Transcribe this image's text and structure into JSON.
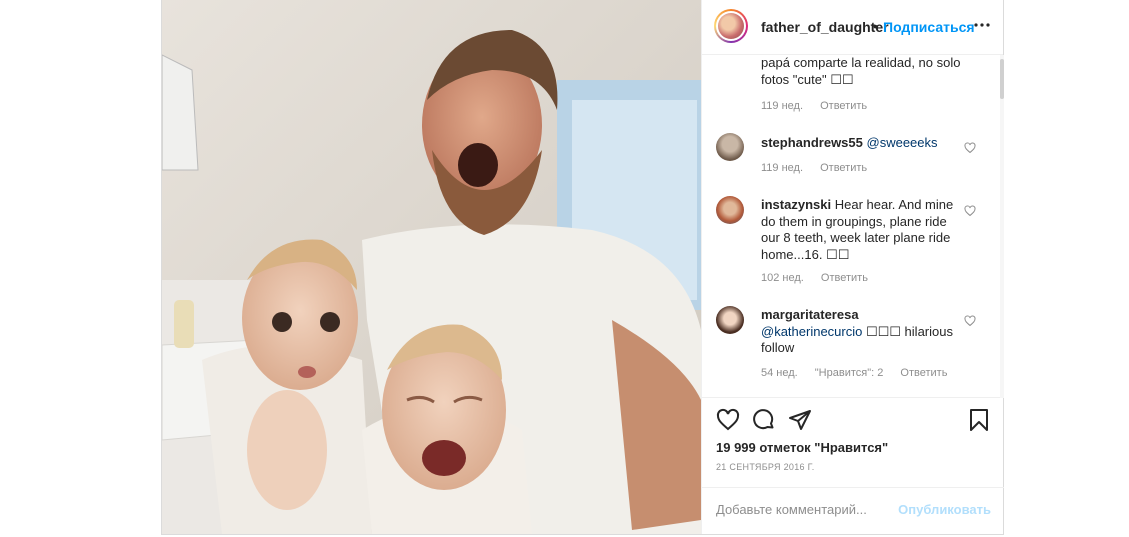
{
  "header": {
    "username": "father_of_daughter",
    "separator": "•",
    "follow_label": "Подписаться",
    "more_icon": "more-dots-icon"
  },
  "comments": [
    {
      "text": "papá comparte la realidad, no solo fotos \"cute\" ☐☐",
      "age": "119 нед.",
      "reply": "Ответить"
    },
    {
      "user": "stephandrews55",
      "mention": "@sweeeeks",
      "text": "",
      "age": "119 нед.",
      "reply": "Ответить"
    },
    {
      "user": "instazynski",
      "text": "Hear hear. And mine do them in groupings, plane ride our 8 teeth, week later plane ride home...16. ☐☐",
      "age": "102 нед.",
      "reply": "Ответить"
    },
    {
      "user": "margaritateresa",
      "mention": "@katherinecurcio",
      "text": "☐☐☐ hilarious follow",
      "age": "54 нед.",
      "likes": "\"Нравится\": 2",
      "reply": "Ответить"
    }
  ],
  "actions": {
    "like_icon": "heart-icon",
    "comment_icon": "comment-icon",
    "share_icon": "send-icon",
    "save_icon": "bookmark-icon",
    "likes": "19 999 отметок \"Нравится\"",
    "date": "21 сентября 2016 г."
  },
  "add_comment": {
    "placeholder": "Добавьте комментарий...",
    "publish_label": "Опубликовать"
  },
  "colors": {
    "accent": "#0095f6",
    "publish_disabled": "#b2dffc",
    "mention": "#00376b",
    "muted": "#8e8e8e"
  }
}
